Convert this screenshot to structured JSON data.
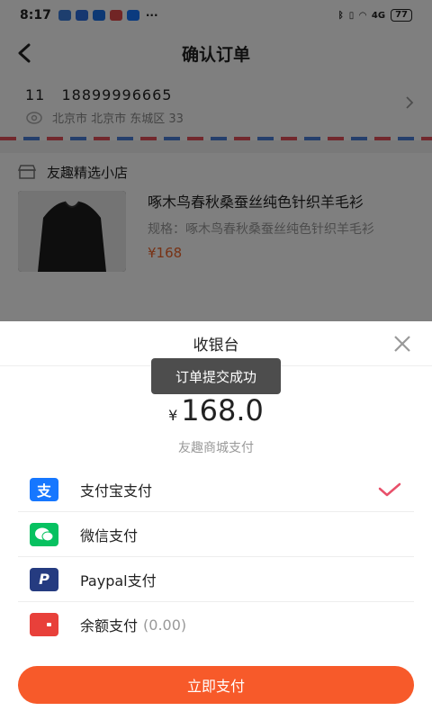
{
  "status_bar": {
    "time": "8:17",
    "more": "···",
    "network": "4G",
    "battery": "77"
  },
  "header": {
    "title": "确认订单"
  },
  "address": {
    "name": "11",
    "phone": "18899996665",
    "detail": "北京市 北京市 东城区 33"
  },
  "shop": {
    "name": "友趣精选小店",
    "product": {
      "name": "啄木鸟春秋桑蚕丝纯色针织羊毛衫",
      "spec": "规格：啄木鸟春秋桑蚕丝纯色针织羊毛衫",
      "price": "¥168"
    }
  },
  "cashier": {
    "title": "收银台",
    "toast": "订单提交成功",
    "currency": "¥",
    "amount": "168.0",
    "merchant": "友趣商城支付",
    "methods": [
      {
        "label": "支付宝支付",
        "icon": "alipay-icon",
        "color": "#1677ff",
        "selected": true
      },
      {
        "label": "微信支付",
        "icon": "wechat-icon",
        "color": "#07c160",
        "selected": false
      },
      {
        "label": "Paypal支付",
        "icon": "paypal-icon",
        "color": "#253b80",
        "selected": false
      },
      {
        "label": "余额支付",
        "extra": "(0.00)",
        "icon": "wallet-icon",
        "color": "#e8403a",
        "selected": false
      }
    ],
    "pay_button": "立即支付"
  },
  "colors": {
    "accent": "#f75a2a",
    "check": "#e8506a"
  }
}
